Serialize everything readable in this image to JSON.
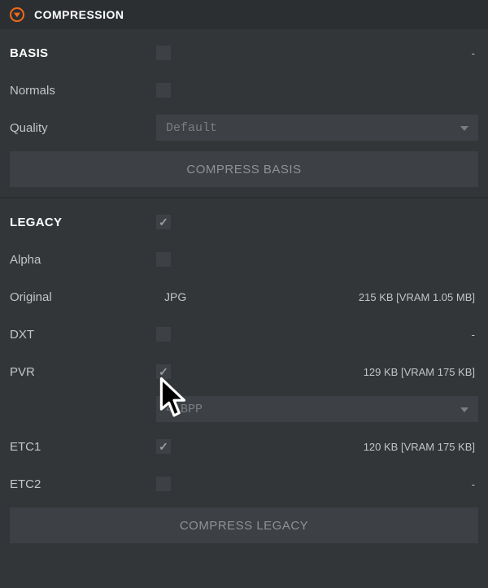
{
  "panel": {
    "title": "COMPRESSION"
  },
  "basis": {
    "heading": "BASIS",
    "checked": false,
    "info": "-",
    "normals_label": "Normals",
    "normals_checked": false,
    "quality_label": "Quality",
    "quality_value": "Default",
    "button": "COMPRESS BASIS"
  },
  "legacy": {
    "heading": "LEGACY",
    "checked": true,
    "alpha_label": "Alpha",
    "alpha_checked": false,
    "original_label": "Original",
    "original_format": "JPG",
    "original_info": "215 KB [VRAM 1.05 MB]",
    "dxt_label": "DXT",
    "dxt_checked": false,
    "dxt_info": "-",
    "pvr_label": "PVR",
    "pvr_checked": true,
    "pvr_info": "129 KB [VRAM 175 KB]",
    "pvr_select_value": "4 BPP",
    "etc1_label": "ETC1",
    "etc1_checked": true,
    "etc1_info": "120 KB [VRAM 175 KB]",
    "etc2_label": "ETC2",
    "etc2_checked": false,
    "etc2_info": "-",
    "button": "COMPRESS LEGACY"
  }
}
